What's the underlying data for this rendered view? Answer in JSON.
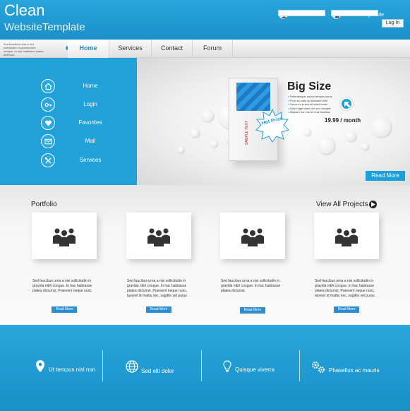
{
  "header": {
    "title": "Clean",
    "subtitle": "WebsiteTemplate",
    "personal_id_label": "Personal ID",
    "security_code_label": "Security Code",
    "login_button": "Log In"
  },
  "nav": {
    "blurb": "Sed faucibus urna a nisi sollicitudin in gravida nibh congue. In hac habitasse platea dictumst.",
    "items": [
      "Home",
      "Services",
      "Contact",
      "Forum"
    ]
  },
  "sidebar": {
    "items": [
      {
        "label": "Home",
        "icon": "home-icon"
      },
      {
        "label": "Login",
        "icon": "key-icon"
      },
      {
        "label": "Favorites",
        "icon": "heart-icon"
      },
      {
        "label": "Mail",
        "icon": "mail-icon"
      },
      {
        "label": "Services",
        "icon": "tools-icon"
      }
    ]
  },
  "hero": {
    "heading": "Big Size",
    "bullets": [
      "Pellentesque auctor tempus lacus",
      "Proin eu odio ac tincidunt velit",
      "Fusce eu purus sit amet lorem",
      "Morbi eget diam nec orci semper",
      "Aliquam non nisi et erat faucibus"
    ],
    "price": "19.99 / month",
    "badge": "Hot Price",
    "box_text": "SAMPLE TEXT",
    "read_more": "Read More",
    "accent": "#1ba0da"
  },
  "portfolio": {
    "title": "Portfolio",
    "view_all": "View All Projects",
    "cards": [
      {
        "text": "Sed faucibus urna a nisi sollicitudin in gravida nibh congue. In hac habitasse platea dictumst. Praesent neque nunc",
        "button": "Read More"
      },
      {
        "text": "Sed faucibus urna a nisi sollicitudin in gravida nibh congue. In hac habitasse platea dictumst. Praesent neque nunc, laoreet id mattis nec, sagittis vel purus.",
        "button": "Read More"
      },
      {
        "text": "Sed faucibus urna a nisi sollicitudin in gravida nibh congue. In hac habitasse platea dictumst.",
        "button": "Read More"
      },
      {
        "text": "Sed faucibus urna a nisi sollicitudin in gravida nibh congue. In hac habitasse platea dictumst. Praesent neque nunc, laoreet id mattis nec, sagittis vel purus.",
        "button": "Read More"
      }
    ]
  },
  "footer": {
    "items": [
      {
        "label": "Ut tempus nisl non",
        "icon": "location-pin-icon"
      },
      {
        "label": "Sed elit dolor",
        "icon": "globe-icon"
      },
      {
        "label": "Quisque viverra",
        "icon": "lightbulb-icon"
      },
      {
        "label": "Phasellus ac mauris",
        "icon": "gears-icon"
      }
    ]
  }
}
